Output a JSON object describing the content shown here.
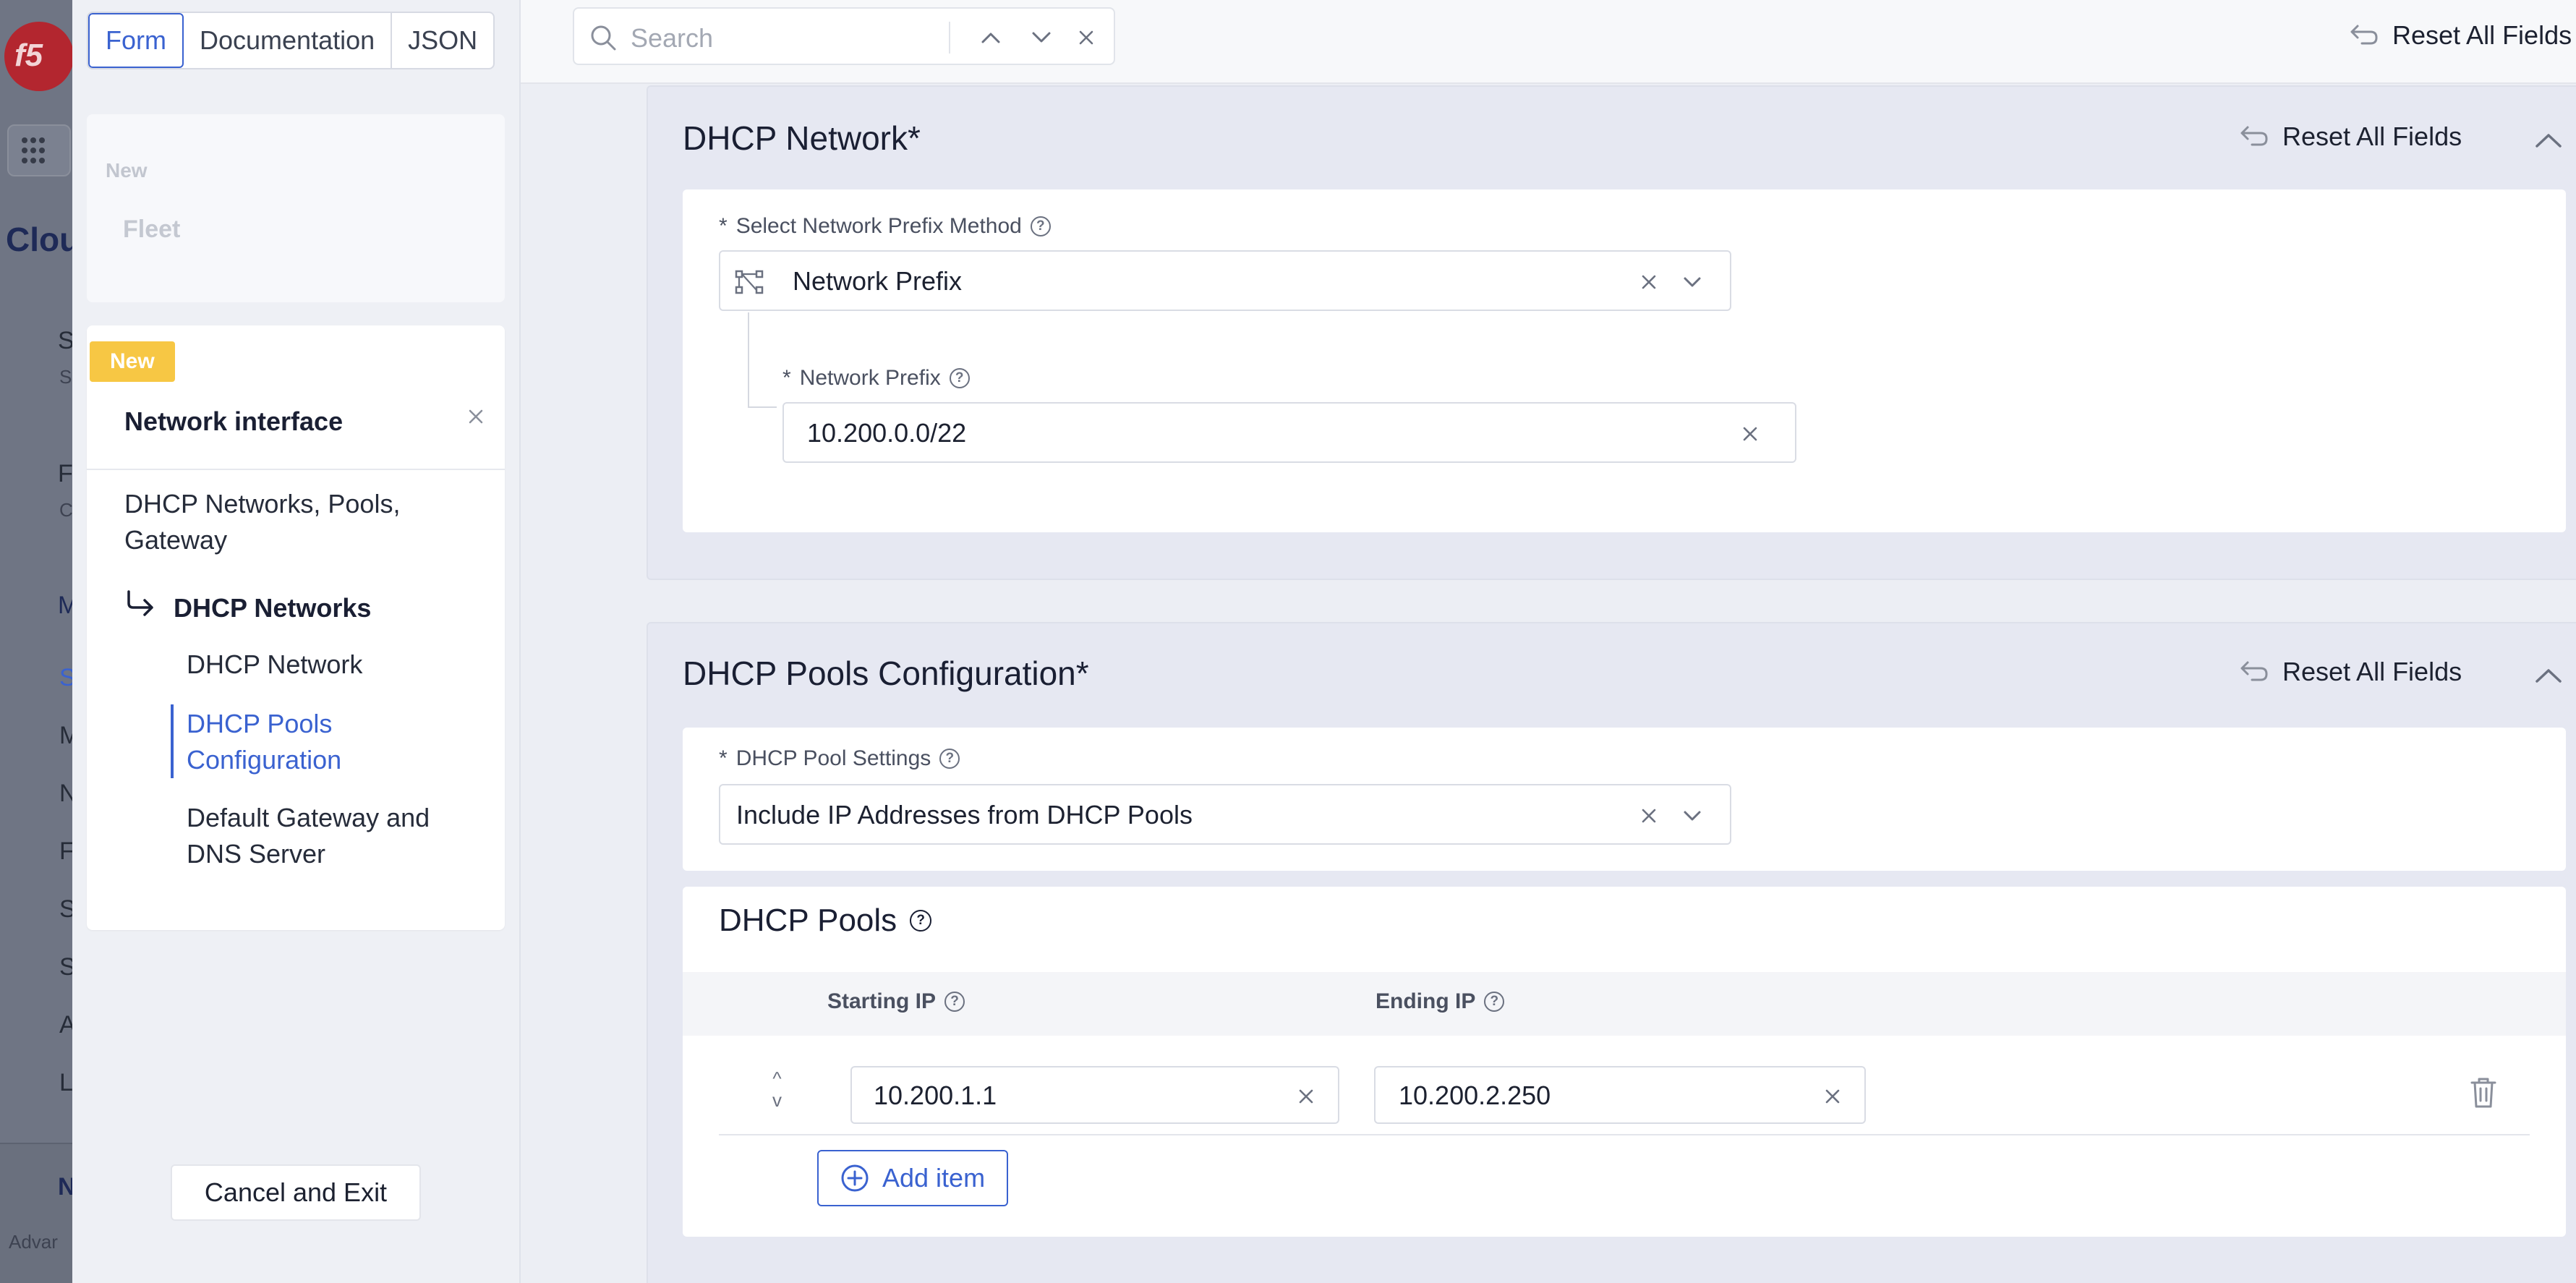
{
  "background_app": {
    "logo_text": "f5",
    "title_fragment": "Clou",
    "nav_letters": [
      "S",
      "F",
      "M",
      "S",
      "M",
      "N",
      "F",
      "S",
      "S",
      "A",
      "L",
      "N"
    ],
    "sub_letters": [
      "S",
      "C"
    ],
    "bottom_text": "Advar"
  },
  "tabs": {
    "form": "Form",
    "documentation": "Documentation",
    "json": "JSON"
  },
  "sidebar": {
    "fleet_card": {
      "badge": "New",
      "title": "Fleet"
    },
    "ni_card": {
      "badge": "New",
      "title": "Network interface",
      "nav_group": "DHCP Networks, Pools, Gateway",
      "nav_sub": "DHCP Networks",
      "items": [
        "DHCP Network",
        "DHCP Pools Configuration",
        "Default Gateway and DNS Server"
      ],
      "active_item": "DHCP Pools Configuration"
    },
    "cancel_label": "Cancel and Exit"
  },
  "search": {
    "placeholder": "Search"
  },
  "reset_all_label": "Reset All Fields",
  "dhcp_network": {
    "title": "DHCP Network",
    "required_mark": "*",
    "reset_label": "Reset All Fields",
    "prefix_method_label": "Select Network Prefix Method",
    "prefix_method_value": "Network Prefix",
    "network_prefix_label": "Network Prefix",
    "network_prefix_value": "10.200.0.0/22"
  },
  "dhcp_pools_config": {
    "title": "DHCP Pools Configuration",
    "required_mark": "*",
    "reset_label": "Reset All Fields",
    "pool_settings_label": "DHCP Pool Settings",
    "pool_settings_value": "Include IP Addresses from DHCP Pools",
    "pools_title": "DHCP Pools",
    "columns": [
      "Starting IP",
      "Ending IP"
    ],
    "rows": [
      {
        "starting_ip": "10.200.1.1",
        "ending_ip": "10.200.2.250"
      }
    ],
    "add_item_label": "Add item"
  },
  "required_prefix": "*",
  "colors": {
    "accent": "#3a62d0",
    "badge": "#f7c744",
    "brand": "#b3262f"
  }
}
